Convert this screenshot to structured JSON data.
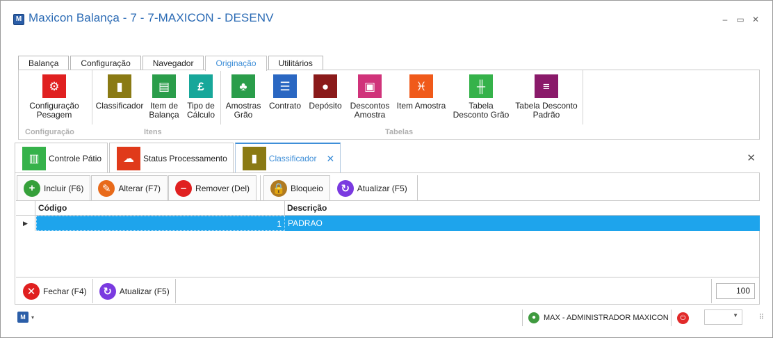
{
  "window": {
    "title": "Maxicon Balança - 7 - 7-MAXICON - DESENV",
    "minimize_icon": "minimize-icon",
    "maximize_icon": "maximize-icon",
    "close_icon": "close-icon"
  },
  "ribbon": {
    "tabs": [
      {
        "label": "Balança",
        "active": false
      },
      {
        "label": "Configuração",
        "active": false
      },
      {
        "label": "Navegador",
        "active": false
      },
      {
        "label": "Originação",
        "active": true
      },
      {
        "label": "Utilitários",
        "active": false
      }
    ],
    "groups": {
      "configuracao": {
        "label": "Configuração",
        "buttons": [
          {
            "label": "Configuração\nPesagem",
            "icon": "gear-icon",
            "color": "#e02020"
          }
        ]
      },
      "itens": {
        "label": "Itens",
        "buttons": [
          {
            "label": "Classificador",
            "icon": "bookmark-icon",
            "color": "#8a7a14"
          },
          {
            "label": "Item de\nBalança",
            "icon": "box-icon",
            "color": "#2a9d4a"
          },
          {
            "label": "Tipo de\nCálculo",
            "icon": "pound-icon",
            "color": "#17a79a"
          }
        ]
      },
      "tabelas": {
        "label": "Tabelas",
        "buttons": [
          {
            "label": "Amostras\nGrão",
            "icon": "plant-icon",
            "color": "#2a9d4a"
          },
          {
            "label": "Contrato",
            "icon": "contract-icon",
            "color": "#2a67c2"
          },
          {
            "label": "Depósito",
            "icon": "map-pin-icon",
            "color": "#8a1a1a"
          },
          {
            "label": "Descontos\nAmostra",
            "icon": "discount-icon",
            "color": "#d0337a"
          },
          {
            "label": "Item Amostra",
            "icon": "pisces-icon",
            "color": "#f05a1a"
          },
          {
            "label": "Tabela\nDesconto Grão",
            "icon": "grain-table-icon",
            "color": "#35b24a"
          },
          {
            "label": "Tabela Desconto\nPadrão",
            "icon": "list-icon",
            "color": "#8a1a6a"
          }
        ]
      }
    }
  },
  "doc_tabs": [
    {
      "label": "Controle Pátio",
      "icon": "chart-icon",
      "color": "#35b24a",
      "active": false
    },
    {
      "label": "Status Processamento",
      "icon": "cloud-sync-icon",
      "color": "#e03a1a",
      "active": false
    },
    {
      "label": "Classificador",
      "icon": "bookmark-icon",
      "color": "#8a7a14",
      "active": true
    }
  ],
  "toolbar": {
    "incluir": {
      "label": "Incluir (F6)",
      "icon": "plus-icon",
      "color": "#35a03a"
    },
    "alterar": {
      "label": "Alterar (F7)",
      "icon": "pencil-icon",
      "color": "#e86a1a"
    },
    "remover": {
      "label": "Remover (Del)",
      "icon": "minus-icon",
      "color": "#e02020"
    },
    "bloqueio": {
      "label": "Bloqueio",
      "icon": "lock-icon",
      "color": "#b07a20"
    },
    "atualizar": {
      "label": "Atualizar (F5)",
      "icon": "refresh-icon",
      "color": "#7a3ae0"
    }
  },
  "grid": {
    "columns": [
      "Código",
      "Descrição"
    ],
    "rows": [
      {
        "codigo": "1",
        "descricao": "PADRAO"
      }
    ]
  },
  "footer": {
    "fechar": {
      "label": "Fechar (F4)",
      "icon": "x-circle-icon",
      "color": "#e02020"
    },
    "atualizar": {
      "label": "Atualizar (F5)",
      "icon": "refresh-icon",
      "color": "#7a3ae0"
    },
    "page_size": "100"
  },
  "statusbar": {
    "user": "MAX - ADMINISTRADOR MAXICON",
    "combo_value": ""
  }
}
